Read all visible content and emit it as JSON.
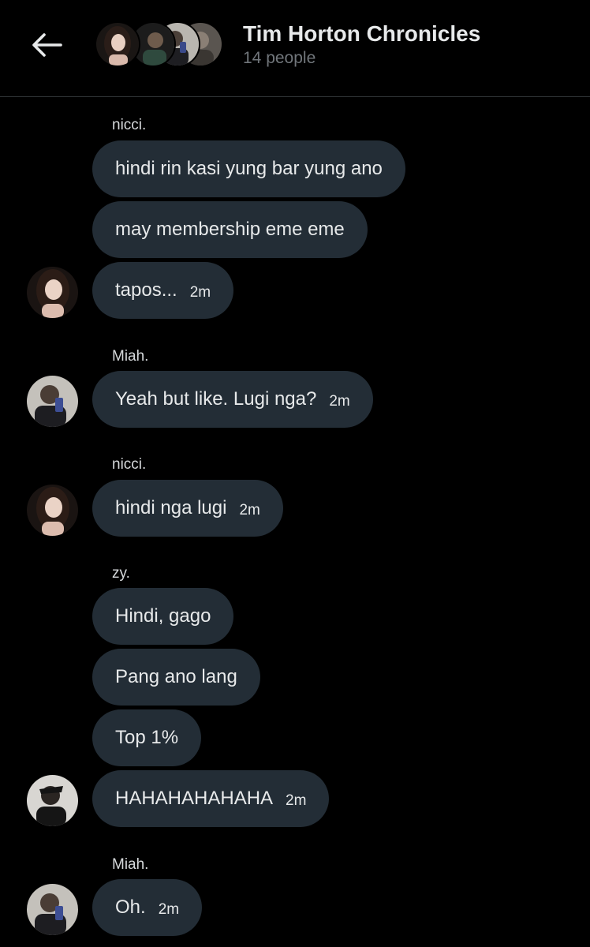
{
  "header": {
    "title": "Tim Horton Chronicles",
    "subtitle": "14 people",
    "back_icon": "arrow-left-icon",
    "avatars": [
      "avatar-nicci",
      "avatar-2",
      "avatar-miah",
      "avatar-4"
    ]
  },
  "messages": {
    "g1": {
      "sender": "nicci.",
      "b1": "hindi rin kasi yung bar yung ano",
      "b2": "may membership eme eme",
      "b3": "tapos...",
      "time": "2m"
    },
    "g2": {
      "sender": "Miah.",
      "b1": "Yeah but like. Lugi nga?",
      "time": "2m"
    },
    "g3": {
      "sender": "nicci.",
      "b1": "hindi nga lugi",
      "time": "2m"
    },
    "g4": {
      "sender": "zy.",
      "b1": "Hindi, gago",
      "b2": "Pang ano lang",
      "b3": "Top 1%",
      "b4": "HAHAHAHAHAHA",
      "time": "2m"
    },
    "g5": {
      "sender": "Miah.",
      "b1": "Oh.",
      "time": "2m"
    }
  },
  "colors": {
    "background": "#000000",
    "bubble": "#232d36",
    "text": "#e7e9ea",
    "muted": "#71767b",
    "divider": "#2f3336"
  }
}
